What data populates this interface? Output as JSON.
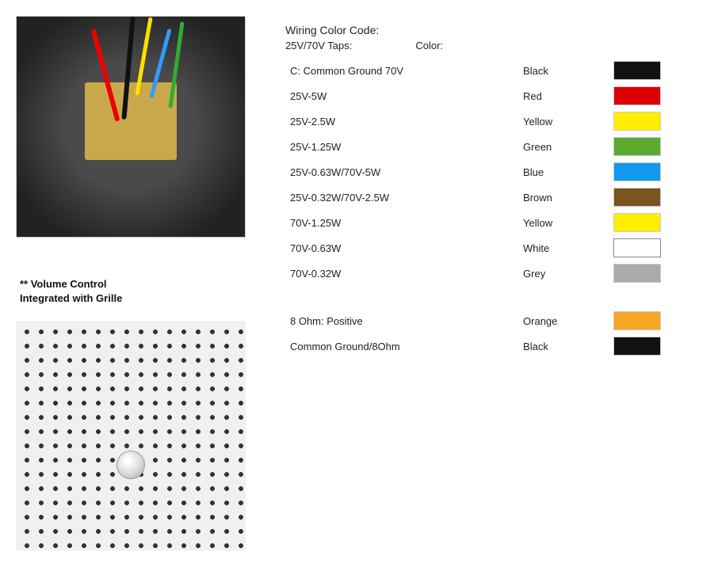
{
  "wiring": {
    "title": "Wiring Color Code:",
    "subtitle_taps": "25V/70V Taps:",
    "subtitle_color": "Color:",
    "rows": [
      {
        "tap": "C: Common Ground 70V",
        "color": "Black",
        "swatch": "#111111"
      },
      {
        "tap": "25V-5W",
        "color": "Red",
        "swatch": "#dd0000"
      },
      {
        "tap": "25V-2.5W",
        "color": "Yellow",
        "swatch": "#ffee00"
      },
      {
        "tap": "25V-1.25W",
        "color": "Green",
        "swatch": "#5aaa30"
      },
      {
        "tap": "25V-0.63W/70V-5W",
        "color": "Blue",
        "swatch": "#1199ee"
      },
      {
        "tap": "25V-0.32W/70V-2.5W",
        "color": "Brown",
        "swatch": "#7a5520"
      },
      {
        "tap": "70V-1.25W",
        "color": "Yellow",
        "swatch": "#ffee00"
      },
      {
        "tap": "70V-0.63W",
        "color": "White",
        "swatch": "#ffffff"
      },
      {
        "tap": "70V-0.32W",
        "color": "Grey",
        "swatch": "#aaaaaa"
      }
    ],
    "ohm_rows": [
      {
        "tap": "8 Ohm: Positive",
        "color": "Orange",
        "swatch": "#f5a623"
      },
      {
        "tap": "Common Ground/8Ohm",
        "color": "Black",
        "swatch": "#111111"
      }
    ]
  },
  "volume_label": "** Volume Control Integrated with Grille"
}
